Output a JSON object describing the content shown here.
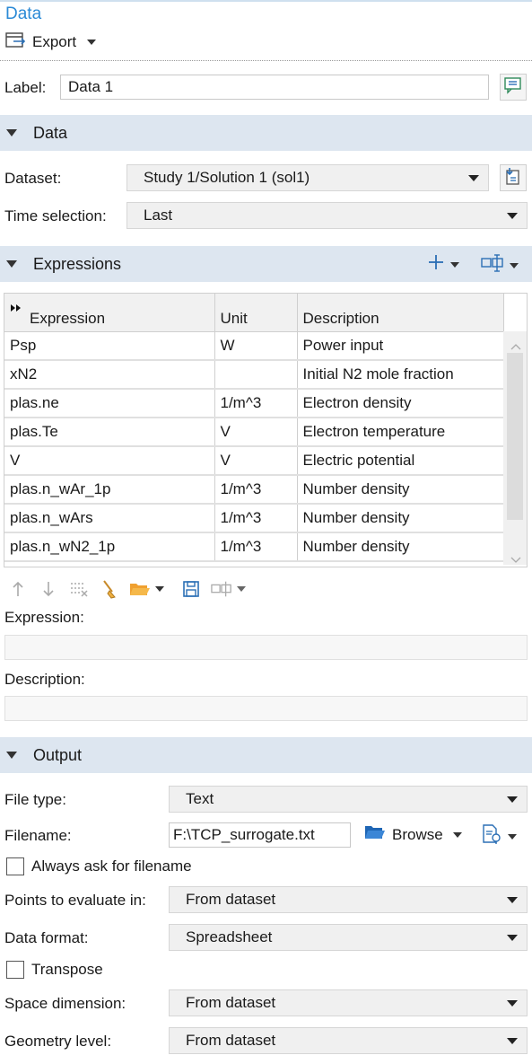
{
  "header": {
    "title": "Data",
    "export_label": "Export"
  },
  "label_row": {
    "label": "Label:",
    "value": "Data 1"
  },
  "data_section": {
    "title": "Data",
    "dataset_label": "Dataset:",
    "dataset_value": "Study 1/Solution 1 (sol1)",
    "time_label": "Time selection:",
    "time_value": "Last"
  },
  "expressions_section": {
    "title": "Expressions",
    "columns": [
      "Expression",
      "Unit",
      "Description"
    ],
    "rows": [
      {
        "expression": "Psp",
        "unit": "W",
        "description": "Power input"
      },
      {
        "expression": "xN2",
        "unit": "",
        "description": "Initial N2 mole fraction"
      },
      {
        "expression": "plas.ne",
        "unit": "1/m^3",
        "description": "Electron density"
      },
      {
        "expression": "plas.Te",
        "unit": "V",
        "description": "Electron temperature"
      },
      {
        "expression": "V",
        "unit": "V",
        "description": "Electric potential"
      },
      {
        "expression": "plas.n_wAr_1p",
        "unit": "1/m^3",
        "description": "Number density"
      },
      {
        "expression": "plas.n_wArs",
        "unit": "1/m^3",
        "description": "Number density"
      },
      {
        "expression": "plas.n_wN2_1p",
        "unit": "1/m^3",
        "description": "Number density"
      }
    ],
    "expression_label": "Expression:",
    "expression_value": "",
    "description_label": "Description:",
    "description_value": ""
  },
  "output_section": {
    "title": "Output",
    "file_type_label": "File type:",
    "file_type_value": "Text",
    "filename_label": "Filename:",
    "filename_value": "F:\\TCP_surrogate.txt",
    "browse_label": "Browse",
    "always_ask_label": "Always ask for filename",
    "points_label": "Points to evaluate in:",
    "points_value": "From dataset",
    "data_format_label": "Data format:",
    "data_format_value": "Spreadsheet",
    "transpose_label": "Transpose",
    "space_dim_label": "Space dimension:",
    "space_dim_value": "From dataset",
    "geometry_label": "Geometry level:",
    "geometry_value": "From dataset"
  },
  "colors": {
    "accent": "#2b8ad6",
    "section_bg": "#dde6f0",
    "folder": "#f0a030"
  }
}
